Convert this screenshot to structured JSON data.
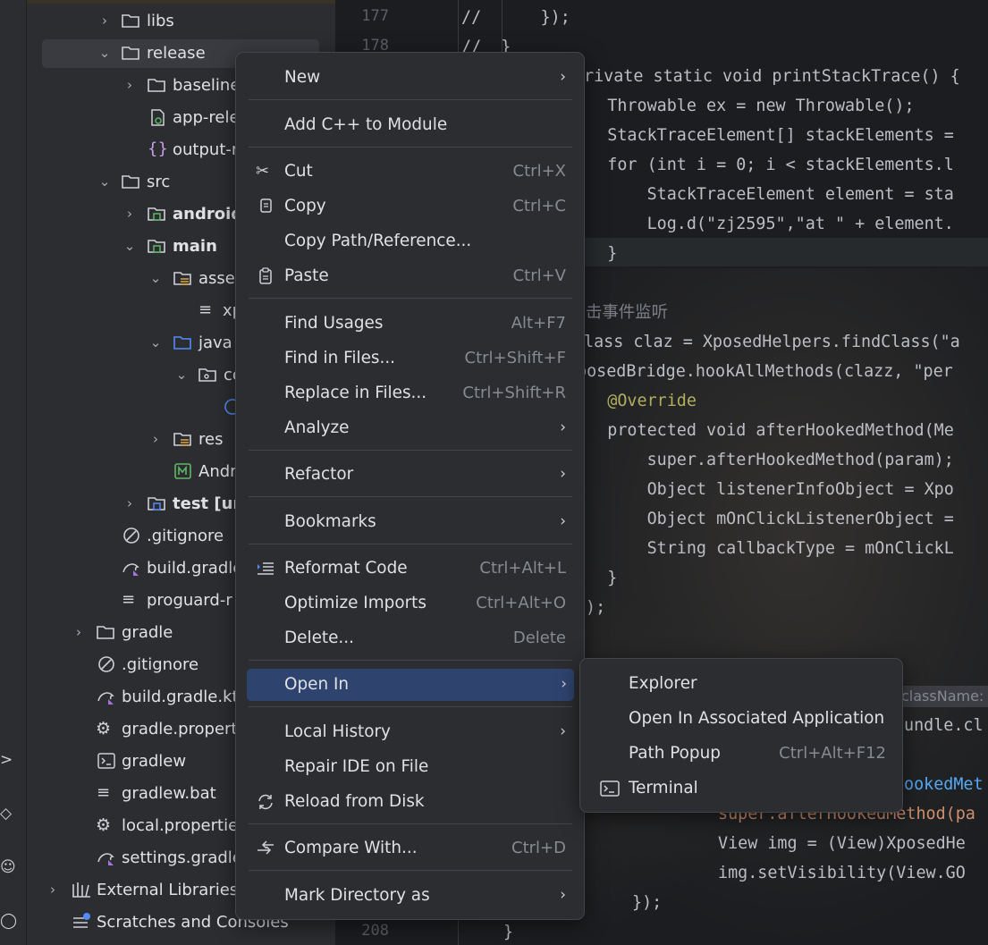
{
  "project_tree": {
    "items": [
      {
        "label": "libs"
      },
      {
        "label": "release"
      },
      {
        "label": "baseline"
      },
      {
        "label": "app-rele"
      },
      {
        "label": "output-r"
      },
      {
        "label": "src"
      },
      {
        "label": "android"
      },
      {
        "label": "main"
      },
      {
        "label": "asset"
      },
      {
        "label": "xp"
      },
      {
        "label": "java"
      },
      {
        "label": "co"
      },
      {
        "label": "res"
      },
      {
        "label": "Andr"
      },
      {
        "label": "test [uni"
      },
      {
        "label": ".gitignore"
      },
      {
        "label": "build.gradle"
      },
      {
        "label": "proguard-r"
      },
      {
        "label": "gradle"
      },
      {
        "label": ".gitignore"
      },
      {
        "label": "build.gradle.kt"
      },
      {
        "label": "gradle.propert"
      },
      {
        "label": "gradlew"
      },
      {
        "label": "gradlew.bat"
      },
      {
        "label": "local.propertie"
      },
      {
        "label": "settings.gradle"
      },
      {
        "label": "External Libraries"
      },
      {
        "label": "Scratches and Consoles"
      }
    ]
  },
  "editor": {
    "line_numbers": [
      "177",
      "178",
      "208"
    ],
    "lines": [
      "//      });",
      "//  }",
      "rivate static void printStackTrace() {",
      "    Throwable ex = new Throwable();",
      "    StackTraceElement[] stackElements =",
      "    for (int i = 0; i < stackElements.l",
      "        StackTraceElement element = sta",
      "        Log.d(\"zj2595\",\"at \" + element.",
      "    }",
      "击事件监听",
      "lass claz = XposedHelpers.findClass(\"a",
      "posedBridge.hookAllMethods(clazz, \"per",
      "    @Override",
      "    protected void afterHookedMethod(Me",
      "        super.afterHookedMethod(param);",
      "        Object listenerInfoObject = Xpo",
      "        Object mOnClickListenerObject =",
      "        String callbackType = mOnClickL",
      "    }",
      ");",
      "undle.cl",
      "ookedMet",
      "super.afterHookedMethod(pa",
      "View img = (View)XposedHe",
      "img.setVisibility(View.GO",
      "});",
      "}"
    ],
    "param_hint": "className:"
  },
  "context_menu": {
    "items": [
      {
        "label": "New"
      },
      {
        "label": "Add C++ to Module"
      },
      {
        "label": "Cut",
        "shortcut": "Ctrl+X"
      },
      {
        "label": "Copy",
        "shortcut": "Ctrl+C"
      },
      {
        "label": "Copy Path/Reference..."
      },
      {
        "label": "Paste",
        "shortcut": "Ctrl+V"
      },
      {
        "label": "Find Usages",
        "shortcut": "Alt+F7"
      },
      {
        "label": "Find in Files...",
        "shortcut": "Ctrl+Shift+F"
      },
      {
        "label": "Replace in Files...",
        "shortcut": "Ctrl+Shift+R"
      },
      {
        "label": "Analyze"
      },
      {
        "label": "Refactor"
      },
      {
        "label": "Bookmarks"
      },
      {
        "label": "Reformat Code",
        "shortcut": "Ctrl+Alt+L"
      },
      {
        "label": "Optimize Imports",
        "shortcut": "Ctrl+Alt+O"
      },
      {
        "label": "Delete...",
        "shortcut": "Delete"
      },
      {
        "label": "Open In"
      },
      {
        "label": "Local History"
      },
      {
        "label": "Repair IDE on File"
      },
      {
        "label": "Reload from Disk"
      },
      {
        "label": "Compare With...",
        "shortcut": "Ctrl+D"
      },
      {
        "label": "Mark Directory as"
      }
    ]
  },
  "submenu": {
    "items": [
      {
        "label": "Explorer"
      },
      {
        "label": "Open In Associated Application"
      },
      {
        "label": "Path Popup",
        "shortcut": "Ctrl+Alt+F12"
      },
      {
        "label": "Terminal"
      }
    ]
  },
  "colors": {
    "menu_highlight": "#2e436e",
    "panel_bg": "#2b2d30",
    "keyword": "#cf8e6d",
    "annotation": "#b3ae60"
  }
}
